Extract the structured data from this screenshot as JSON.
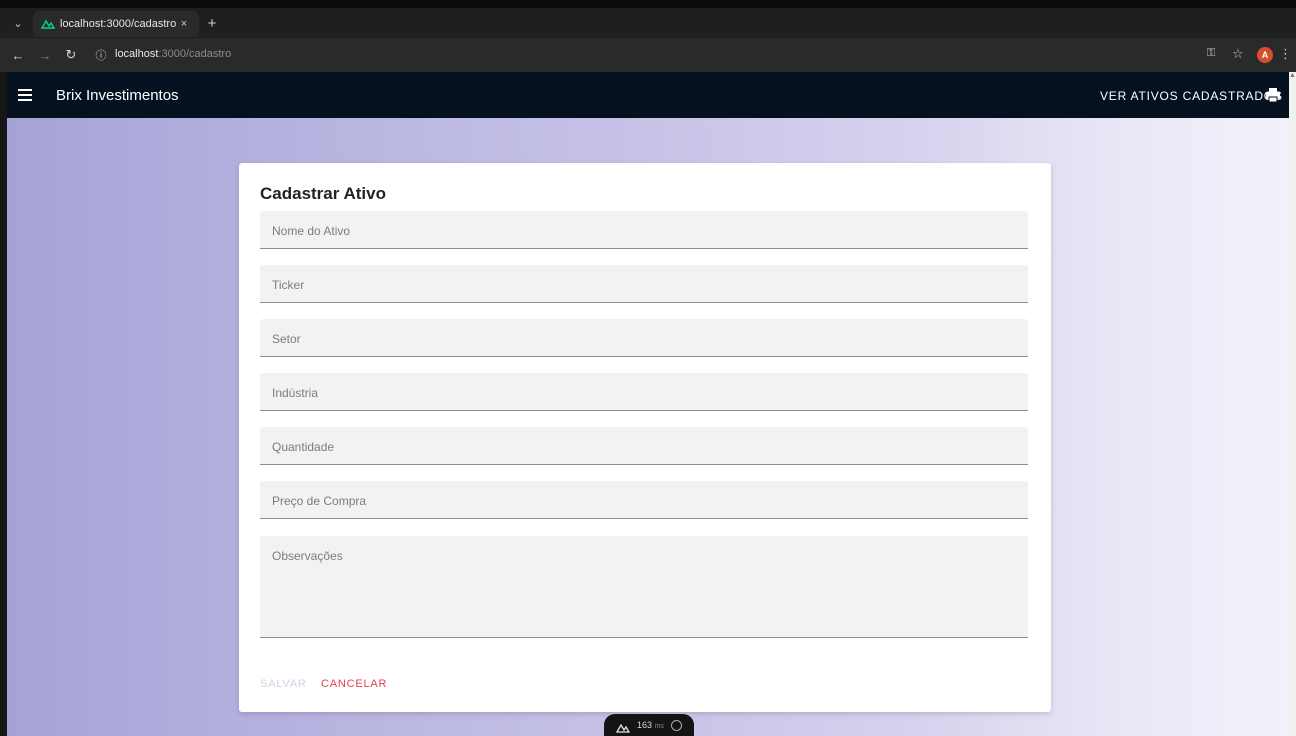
{
  "browser": {
    "tab_title": "localhost:3000/cadastro",
    "tab_close": "×",
    "new_tab": "+",
    "url_host": "localhost",
    "url_path": ":3000/cadastro",
    "avatar_letter": "A"
  },
  "appbar": {
    "brand": "Brix Investimentos",
    "link": "VER ATIVOS CADASTRADOS"
  },
  "form": {
    "title": "Cadastrar Ativo",
    "fields": [
      {
        "label": "Nome do Ativo"
      },
      {
        "label": "Ticker"
      },
      {
        "label": "Setor"
      },
      {
        "label": "Indústria"
      },
      {
        "label": "Quantidade"
      },
      {
        "label": "Preço de Compra"
      },
      {
        "label": "Observações"
      }
    ],
    "save_label": "SALVAR",
    "cancel_label": "CANCELAR"
  },
  "devtools": {
    "time": "163",
    "unit": "ms"
  },
  "colors": {
    "appbar_bg": "#061120",
    "cancel": "#e0434a",
    "save_disabled": "#d4d1e4"
  }
}
